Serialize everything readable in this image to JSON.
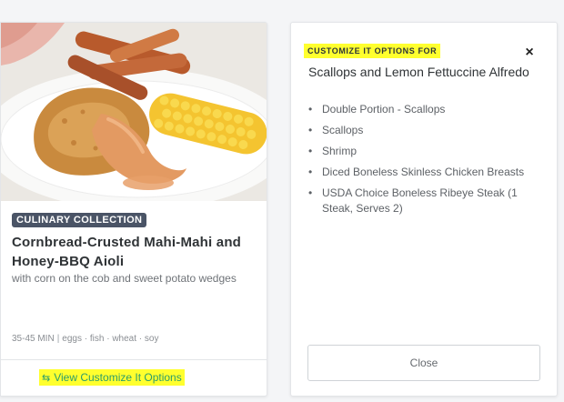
{
  "meal": {
    "image_alt": "Plate with cornbread-crusted fish, corn on the cob and sweet potato wedges",
    "badge": "CULINARY COLLECTION",
    "title": "Cornbread-Crusted Mahi-Mahi and Honey-BBQ Aioli",
    "subtitle": "with corn on the cob and sweet potato wedges",
    "time": "35-45 MIN",
    "allergens": "eggs · fish · wheat · soy",
    "customize_link": "View Customize It Options",
    "customize_icon": "swap-arrows-icon"
  },
  "customize_panel": {
    "for_label": "CUSTOMIZE IT OPTIONS FOR",
    "title": "Scallops and Lemon Fettuccine Alfredo",
    "options": [
      "Double Portion - Scallops",
      "Scallops",
      "Shrimp",
      "Diced Boneless Skinless Chicken Breasts",
      "USDA Choice Boneless Ribeye Steak (1 Steak, Serves 2)"
    ],
    "close_icon": "×",
    "close_button": "Close"
  },
  "colors": {
    "highlight": "#ffff2e",
    "link": "#2c9c6a",
    "badge_bg": "#4a5466"
  }
}
